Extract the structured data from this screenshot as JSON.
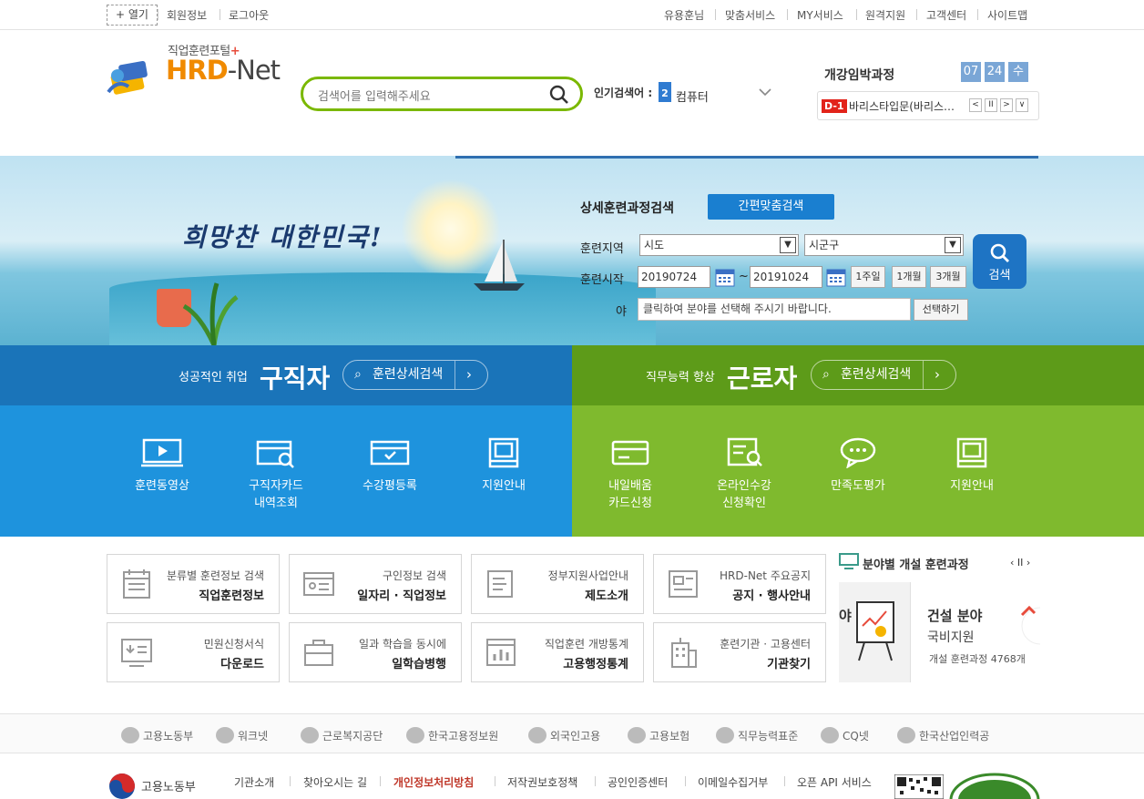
{
  "topbar": {
    "open_label": "+ 열기",
    "member_info": "회원정보",
    "logout": "로그아웃",
    "right_links": [
      "유용훈님",
      "맞춤서비스",
      "MY서비스",
      "원격지원",
      "고객센터",
      "사이트맵"
    ]
  },
  "logo": {
    "sub": "직업훈련포털",
    "plus": "+",
    "main_a": "HRD",
    "main_b": "-Net"
  },
  "search": {
    "placeholder": "검색어를 입력해주세요"
  },
  "popular": {
    "label": "인기검색어 :",
    "rank": "2",
    "keyword": "컴퓨터"
  },
  "opening": {
    "title": "개강임박과정",
    "month": "07",
    "day": "24",
    "weekday": "수",
    "dday": "D-1",
    "course": "바리스타입문(바리스…",
    "controls": [
      "<",
      "II",
      ">",
      "∨"
    ]
  },
  "banner": {
    "slogan": "희망찬 대한민국!"
  },
  "advanced": {
    "title": "상세훈련과정검색",
    "easy_button": "간편맞춤검색",
    "region_label": "훈련지역",
    "sido": "시도",
    "sigungu": "시군구",
    "start_label": "훈련시작",
    "date_from": "20190724",
    "tilde": "~",
    "date_to": "20191024",
    "periods": [
      "1주일",
      "1개월",
      "3개월"
    ],
    "field_label_tail": "야",
    "field_placeholder": "클릭하여 분야를 선택해 주시기 바랍니다.",
    "choose_button": "선택하기",
    "search_button": "검색"
  },
  "tabs": {
    "left": {
      "sub": "성공적인 취업",
      "big": "구직자",
      "btn": "훈련상세검색"
    },
    "right": {
      "sub": "직무능력 향상",
      "big": "근로자",
      "btn": "훈련상세검색"
    }
  },
  "quick_left": [
    {
      "l1": "훈련동영상",
      "l2": ""
    },
    {
      "l1": "구직자카드",
      "l2": "내역조회"
    },
    {
      "l1": "수강평등록",
      "l2": ""
    },
    {
      "l1": "지원안내",
      "l2": ""
    }
  ],
  "quick_right": [
    {
      "l1": "내일배움",
      "l2": "카드신청"
    },
    {
      "l1": "온라인수강",
      "l2": "신청확인"
    },
    {
      "l1": "만족도평가",
      "l2": ""
    },
    {
      "l1": "지원안내",
      "l2": ""
    }
  ],
  "boxes": [
    {
      "t1": "분류별 훈련정보 검색",
      "t2": "직업훈련정보"
    },
    {
      "t1": "구인정보 검색",
      "t2": "일자리 · 직업정보"
    },
    {
      "t1": "정부지원사업안내",
      "t2": "제도소개"
    },
    {
      "t1": "HRD-Net 주요공지",
      "t2": "공지 · 행사안내"
    },
    {
      "t1": "민원신청서식",
      "t2": "다운로드"
    },
    {
      "t1": "일과 학습을 동시에",
      "t2": "일학습병행"
    },
    {
      "t1": "직업훈련 개방통계",
      "t2": "고용행정통계"
    },
    {
      "t1": "훈련기관 · 고용센터",
      "t2": "기관찾기"
    }
  ],
  "field_courses": {
    "title": "분야별 개설 훈련과정",
    "controls": "‹ II ›",
    "prev_tail": "야",
    "name": "건설 분야",
    "type": "국비지원",
    "count": "개설 훈련과정 4768개"
  },
  "partners": [
    "고용노동부",
    "워크넷",
    "근로복지공단",
    "한국고용정보원",
    "외국인고용",
    "고용보험",
    "직무능력표준",
    "CQ넷",
    "한국산업인력공"
  ],
  "footer": {
    "ministry": "고용노동부",
    "links": [
      "기관소개",
      "찾아오시는 길",
      "개인정보처리방침",
      "저작권보호정책",
      "공인인증센터",
      "이메일수집거부",
      "오픈 API 서비스"
    ],
    "highlight_color": "#c0392b"
  }
}
